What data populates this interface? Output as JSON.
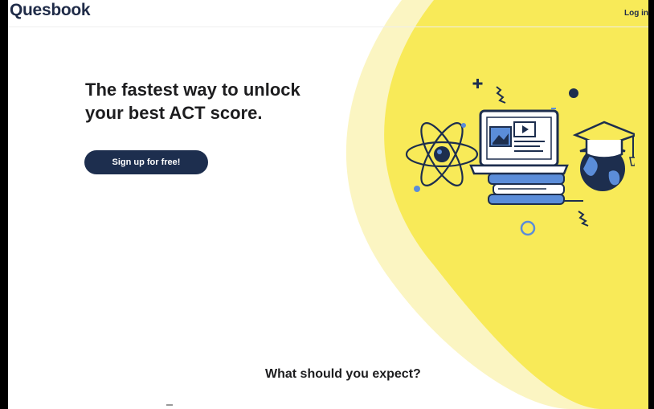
{
  "header": {
    "logo": "Quesbook",
    "login_label": "Log in"
  },
  "hero": {
    "headline": "The fastest way to unlock your best ACT score.",
    "cta_label": "Sign up for free!"
  },
  "section": {
    "expect_title": "What should you expect?"
  },
  "colors": {
    "brand_navy": "#1d2e4e",
    "accent_yellow": "#f8ea58",
    "light_yellow": "#fbf4b8",
    "accent_blue": "#5b8dd9"
  },
  "icons": [
    "atom-icon",
    "laptop-icon",
    "books-icon",
    "graduation-cap-icon",
    "globe-icon",
    "plus-icon",
    "circle-icon"
  ]
}
